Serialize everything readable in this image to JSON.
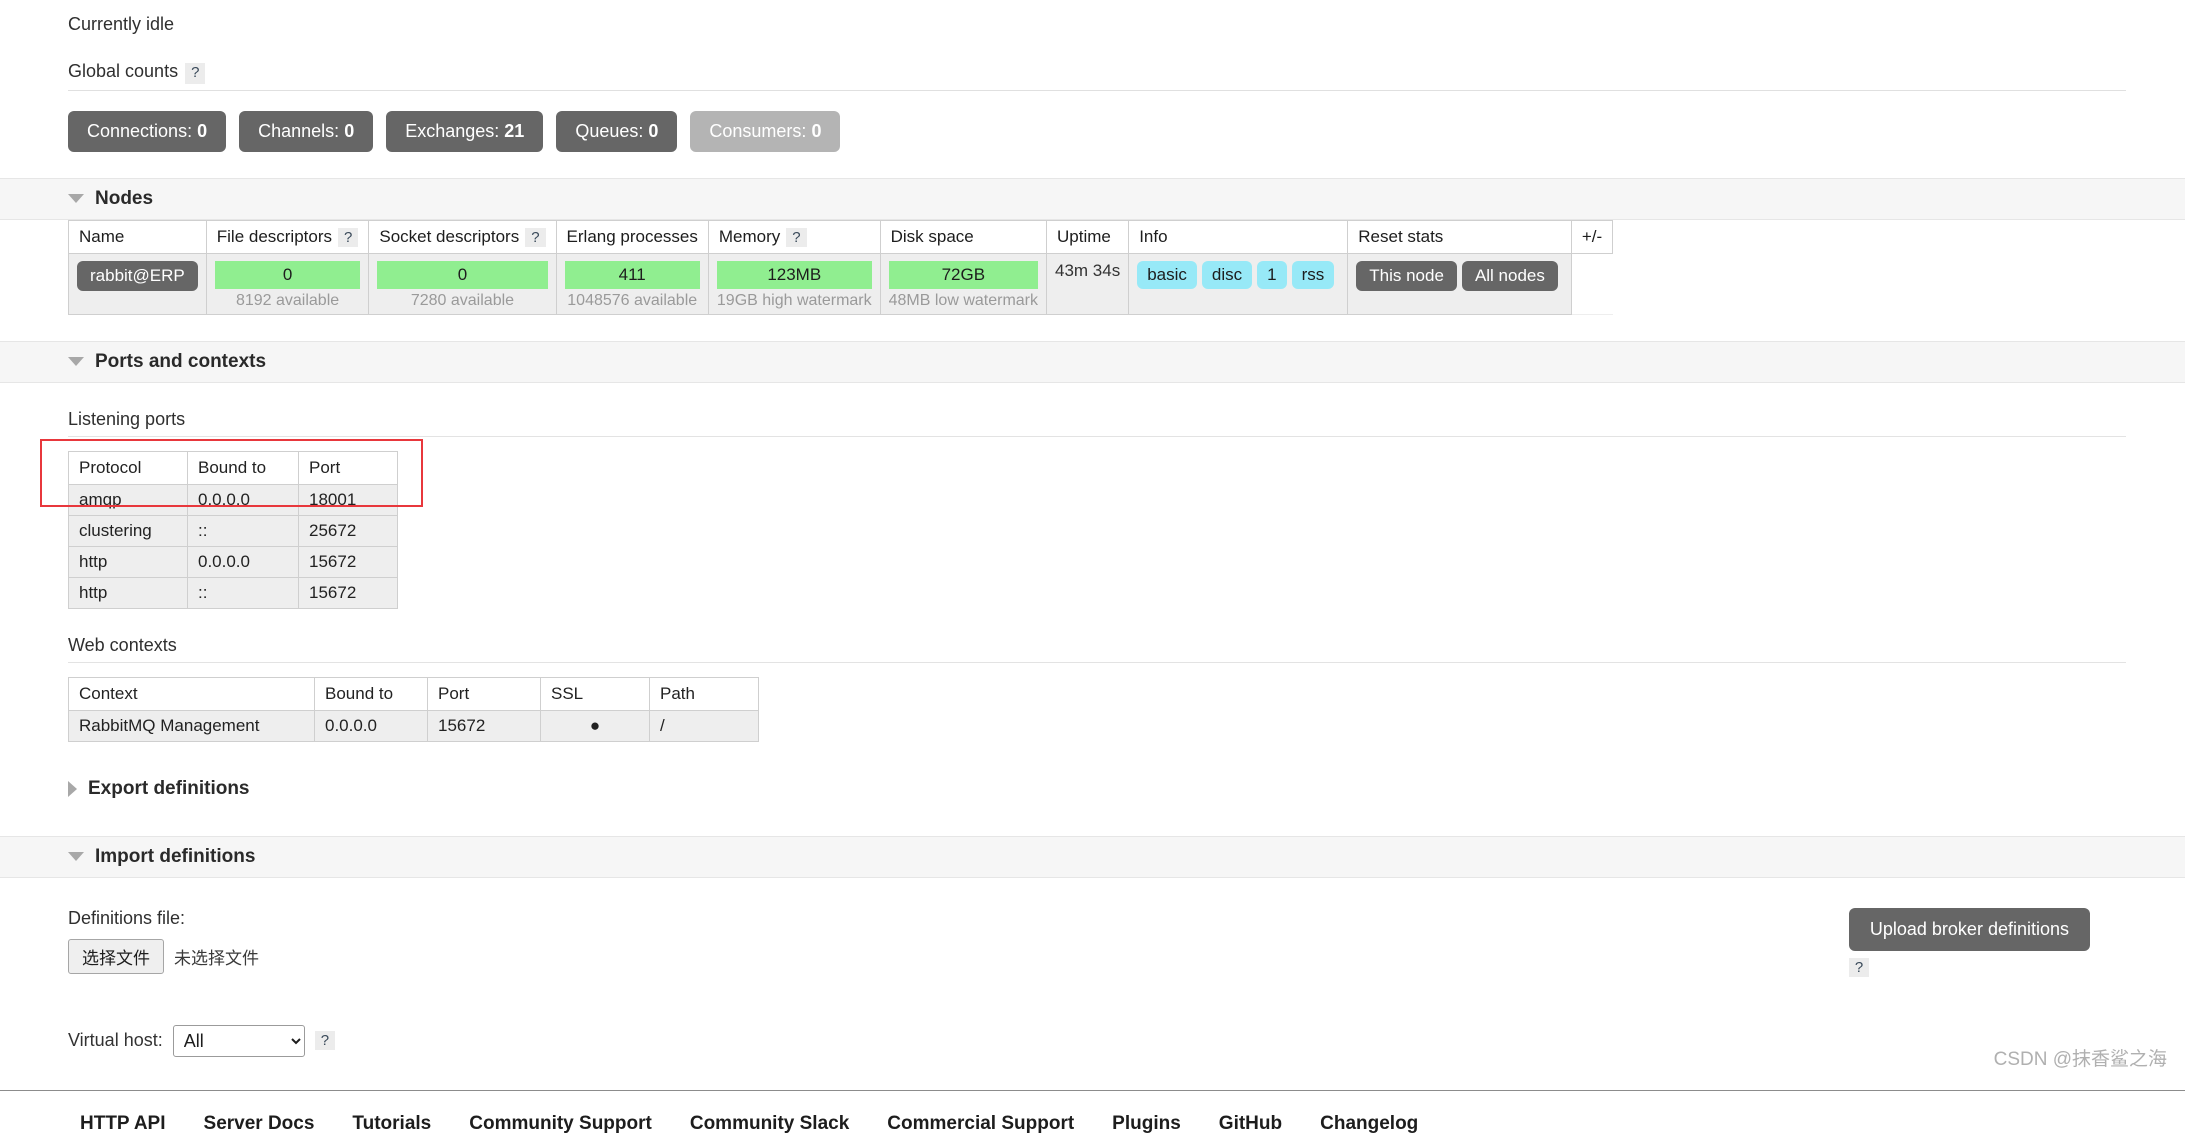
{
  "status": {
    "text": "Currently idle"
  },
  "global_counts": {
    "label": "Global counts",
    "help": "?",
    "pills": [
      {
        "label": "Connections:",
        "value": "0",
        "muted": false
      },
      {
        "label": "Channels:",
        "value": "0",
        "muted": false
      },
      {
        "label": "Exchanges:",
        "value": "21",
        "muted": false
      },
      {
        "label": "Queues:",
        "value": "0",
        "muted": false
      },
      {
        "label": "Consumers:",
        "value": "0",
        "muted": true
      }
    ]
  },
  "nodes_section": {
    "title": "Nodes",
    "headers": {
      "name": "Name",
      "file_descriptors": "File descriptors",
      "socket_descriptors": "Socket descriptors",
      "erlang_processes": "Erlang processes",
      "memory": "Memory",
      "disk_space": "Disk space",
      "uptime": "Uptime",
      "info": "Info",
      "reset_stats": "Reset stats",
      "plusminus": "+/-",
      "help": "?"
    },
    "row": {
      "name": "rabbit@ERP",
      "file_descriptors": "0",
      "file_descriptors_sub": "8192 available",
      "socket_descriptors": "0",
      "socket_descriptors_sub": "7280 available",
      "erlang_processes": "411",
      "erlang_processes_sub": "1048576 available",
      "memory": "123MB",
      "memory_sub": "19GB high watermark",
      "disk_space": "72GB",
      "disk_space_sub": "48MB low watermark",
      "uptime": "43m 34s",
      "info_tags": [
        "basic",
        "disc",
        "1",
        "rss"
      ],
      "reset_this_node": "This node",
      "reset_all_nodes": "All nodes"
    }
  },
  "ports_section": {
    "title": "Ports and contexts",
    "listening_ports": {
      "label": "Listening ports",
      "headers": [
        "Protocol",
        "Bound to",
        "Port"
      ],
      "rows": [
        [
          "amqp",
          "0.0.0.0",
          "18001"
        ],
        [
          "clustering",
          "::",
          "25672"
        ],
        [
          "http",
          "0.0.0.0",
          "15672"
        ],
        [
          "http",
          "::",
          "15672"
        ]
      ]
    },
    "web_contexts": {
      "label": "Web contexts",
      "headers": [
        "Context",
        "Bound to",
        "Port",
        "SSL",
        "Path"
      ],
      "rows": [
        [
          "RabbitMQ Management",
          "0.0.0.0",
          "15672",
          "●",
          "/"
        ]
      ]
    }
  },
  "export_section": {
    "title": "Export definitions"
  },
  "import_section": {
    "title": "Import definitions",
    "definitions_file_label": "Definitions file:",
    "choose_file_button": "选择文件",
    "no_file_text": "未选择文件",
    "upload_button": "Upload broker definitions",
    "upload_help": "?",
    "virtual_host_label": "Virtual host:",
    "virtual_host_value": "All",
    "virtual_host_options": [
      "All"
    ],
    "virtual_host_help": "?"
  },
  "footer": {
    "links": [
      "HTTP API",
      "Server Docs",
      "Tutorials",
      "Community Support",
      "Community Slack",
      "Commercial Support",
      "Plugins",
      "GitHub",
      "Changelog"
    ]
  },
  "watermark": {
    "text": "CSDN @抹香鲨之海"
  },
  "colors": {
    "pill": "#666666",
    "pill_muted": "#b4b4b4",
    "bar_green": "#90ee90",
    "tag_blue": "#97e9f7",
    "annotation_red": "#e8373c"
  }
}
